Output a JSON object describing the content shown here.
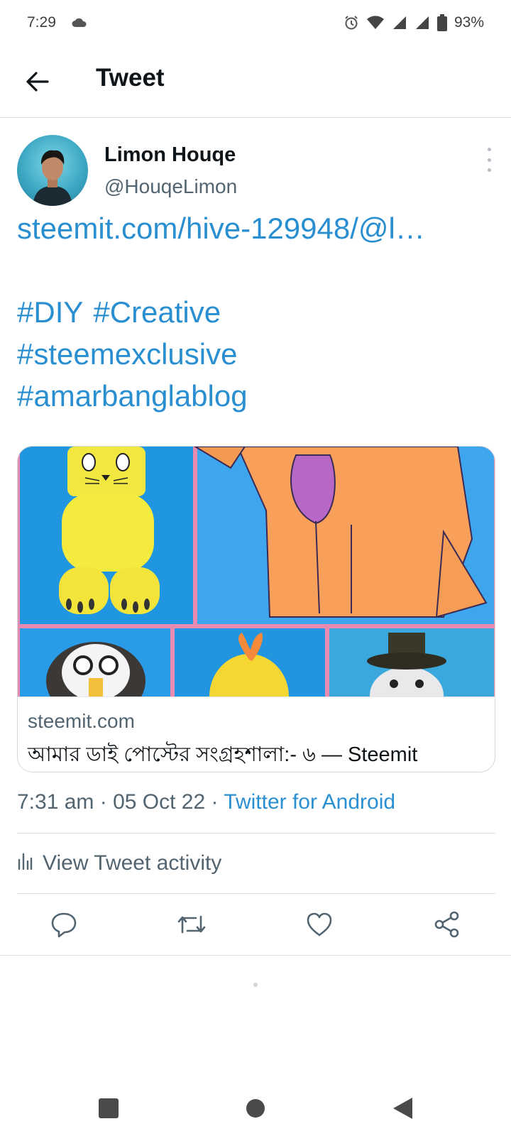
{
  "status_bar": {
    "time": "7:29",
    "battery": "93%",
    "icons": [
      "cloud-icon",
      "alarm-icon",
      "wifi-icon",
      "signal-icon",
      "signal-icon",
      "battery-icon"
    ]
  },
  "header": {
    "title": "Tweet",
    "back_icon": "arrow-left-icon"
  },
  "tweet": {
    "author": {
      "name": "Limon Houqe",
      "handle": "@HouqeLimon"
    },
    "link": "steemit.com/hive-129948/@l…",
    "hashtags_line1": [
      "#DIY",
      "#Creative"
    ],
    "hashtag_line2": "#steemexclusive",
    "hashtag_line3": "#amarbanglablog",
    "card": {
      "domain": "steemit.com",
      "title": "আমার ডাই পোস্টের সংগ্রহশালা:- ৬ — Steemit"
    },
    "meta": {
      "time": "7:31 am",
      "date": "05 Oct 22",
      "source": "Twitter for Android"
    },
    "activity_label": "View Tweet activity",
    "actions": [
      "reply-icon",
      "retweet-icon",
      "like-icon",
      "share-icon"
    ]
  },
  "colors": {
    "link": "#2a8fd0",
    "secondary_text": "#536471",
    "primary_text": "#0f1419"
  },
  "nav_bar": [
    "recents-icon",
    "home-icon",
    "back-icon"
  ]
}
